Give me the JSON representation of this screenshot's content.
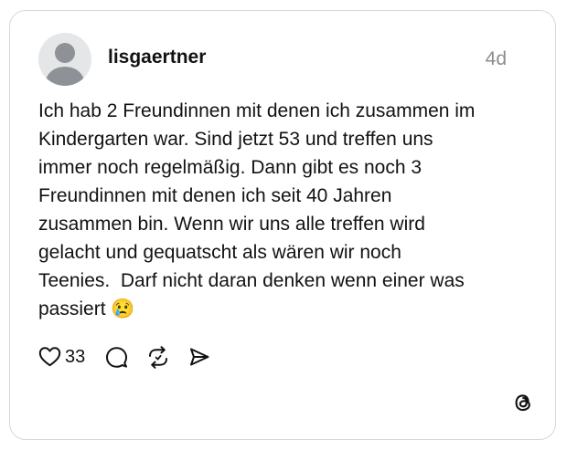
{
  "post": {
    "username": "lisgaertner",
    "timestamp": "4d",
    "text": "Ich hab 2 Freundinnen mit denen ich zusammen im\nKindergarten war. Sind jetzt 53 und treffen uns\nimmer noch regelmäßig. Dann gibt es noch 3\nFreundinnen mit denen ich seit 40 Jahren\nzusammen bin. Wenn wir uns alle treffen wird\ngelacht und gequatscht als wären wir noch\nTeenies.  Darf nicht daran denken wenn einer was\npassiert 😢",
    "like_count": "33"
  },
  "icons": {
    "avatar": "default-avatar-icon",
    "like": "heart-icon",
    "comment": "comment-bubble-icon",
    "repost": "repost-icon",
    "share": "send-icon",
    "brand": "threads-logo-icon"
  },
  "colors": {
    "text": "#121212",
    "muted": "#8c8c8c",
    "border": "#d8d8d8",
    "avatar_bg": "#e4e6e8",
    "avatar_fg": "#8e9297"
  }
}
